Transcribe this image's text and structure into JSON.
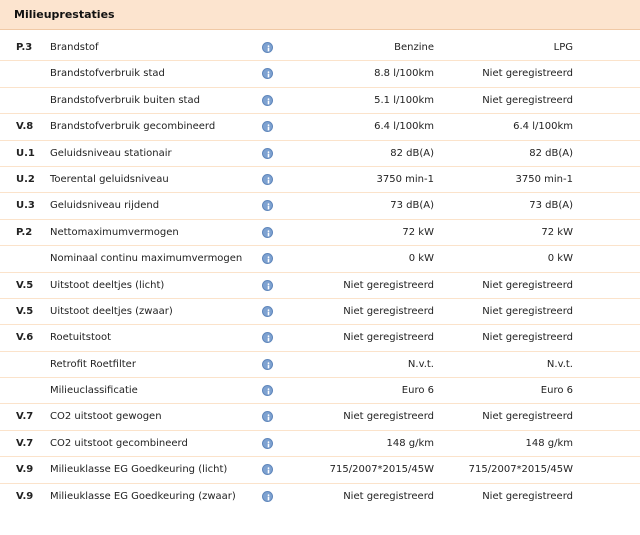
{
  "header": {
    "title": "Milieuprestaties"
  },
  "rows": [
    {
      "code": "P.3",
      "label": "Brandstof",
      "v1": "Benzine",
      "v2": "LPG"
    },
    {
      "code": "",
      "label": "Brandstofverbruik stad",
      "v1": "8.8 l/100km",
      "v2": "Niet geregistreerd"
    },
    {
      "code": "",
      "label": "Brandstofverbruik buiten stad",
      "v1": "5.1 l/100km",
      "v2": "Niet geregistreerd"
    },
    {
      "code": "V.8",
      "label": "Brandstofverbruik gecombineerd",
      "v1": "6.4 l/100km",
      "v2": "6.4 l/100km"
    },
    {
      "code": "U.1",
      "label": "Geluidsniveau stationair",
      "v1": "82 dB(A)",
      "v2": "82 dB(A)"
    },
    {
      "code": "U.2",
      "label": "Toerental geluidsniveau",
      "v1": "3750 min-1",
      "v2": "3750 min-1"
    },
    {
      "code": "U.3",
      "label": "Geluidsniveau rijdend",
      "v1": "73 dB(A)",
      "v2": "73 dB(A)"
    },
    {
      "code": "P.2",
      "label": "Nettomaximumvermogen",
      "v1": "72 kW",
      "v2": "72 kW"
    },
    {
      "code": "",
      "label": "Nominaal continu maximumvermogen",
      "v1": "0 kW",
      "v2": "0 kW"
    },
    {
      "code": "V.5",
      "label": "Uitstoot deeltjes (licht)",
      "v1": "Niet geregistreerd",
      "v2": "Niet geregistreerd"
    },
    {
      "code": "V.5",
      "label": "Uitstoot deeltjes (zwaar)",
      "v1": "Niet geregistreerd",
      "v2": "Niet geregistreerd"
    },
    {
      "code": "V.6",
      "label": "Roetuitstoot",
      "v1": "Niet geregistreerd",
      "v2": "Niet geregistreerd"
    },
    {
      "code": "",
      "label": "Retrofit Roetfilter",
      "v1": "N.v.t.",
      "v2": "N.v.t."
    },
    {
      "code": "",
      "label": "Milieuclassificatie",
      "v1": "Euro 6",
      "v2": "Euro 6"
    },
    {
      "code": "V.7",
      "label": "CO2 uitstoot gewogen",
      "v1": "Niet geregistreerd",
      "v2": "Niet geregistreerd"
    },
    {
      "code": "V.7",
      "label": "CO2 uitstoot gecombineerd",
      "v1": "148 g/km",
      "v2": "148 g/km"
    },
    {
      "code": "V.9",
      "label": "Milieuklasse EG Goedkeuring (licht)",
      "v1": "715/2007*2015/45W",
      "v2": "715/2007*2015/45W"
    },
    {
      "code": "V.9",
      "label": "Milieuklasse EG Goedkeuring (zwaar)",
      "v1": "Niet geregistreerd",
      "v2": "Niet geregistreerd"
    }
  ]
}
